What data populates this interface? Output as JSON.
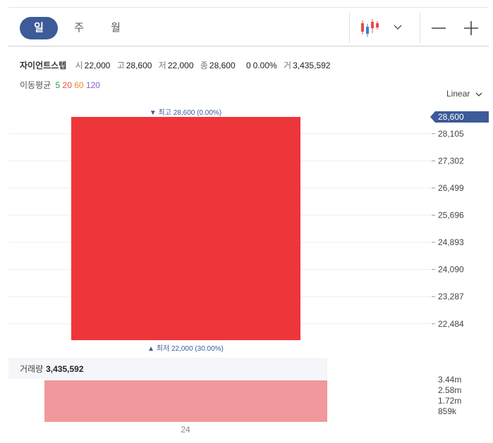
{
  "tabs": {
    "day": "일",
    "week": "주",
    "month": "월"
  },
  "scale_mode": "Linear",
  "stock": {
    "name": "자이언트스텝",
    "open_label": "시",
    "open": "22,000",
    "high_label": "고",
    "high": "28,600",
    "low_label": "저",
    "low": "22,000",
    "close_label": "종",
    "close": "28,600",
    "change": "0",
    "change_pct": "0.00%",
    "volume_label": "거",
    "volume": "3,435,592"
  },
  "moving_average": {
    "label": "이동평균",
    "periods": [
      "5",
      "20",
      "60",
      "120"
    ],
    "colors": [
      "#2aa14a",
      "#e84c4c",
      "#f08a2c",
      "#8a5cd6"
    ]
  },
  "annotations": {
    "high": "▼ 최고 28,600 (0.00%)",
    "low": "▲ 최저 22,000 (30.00%)"
  },
  "volume_panel": {
    "label": "거래량",
    "value": "3,435,592"
  },
  "colors": {
    "up": "#ee363a",
    "volume_bar": "#f0989b",
    "accent": "#3d5a99"
  },
  "chart_data": [
    {
      "type": "candlestick",
      "x": [
        "24"
      ],
      "open": [
        22000
      ],
      "high": [
        28600
      ],
      "low": [
        22000
      ],
      "close": [
        28600
      ],
      "current_price_label": "28,600",
      "ylim": [
        22000,
        28600
      ],
      "y_ticks": [
        28105,
        27302,
        26499,
        25696,
        24893,
        24090,
        23287,
        22484
      ],
      "y_tick_labels": [
        "28,105",
        "27,302",
        "26,499",
        "25,696",
        "24,893",
        "24,090",
        "23,287",
        "22,484"
      ],
      "grid": true
    },
    {
      "type": "bar",
      "categories": [
        "24"
      ],
      "values": [
        3435592
      ],
      "ylim": [
        0,
        3435592
      ],
      "y_ticks": [
        3435592,
        2576694,
        1717796,
        858898
      ],
      "y_tick_labels": [
        "3.44m",
        "2.58m",
        "1.72m",
        "859k"
      ]
    }
  ]
}
